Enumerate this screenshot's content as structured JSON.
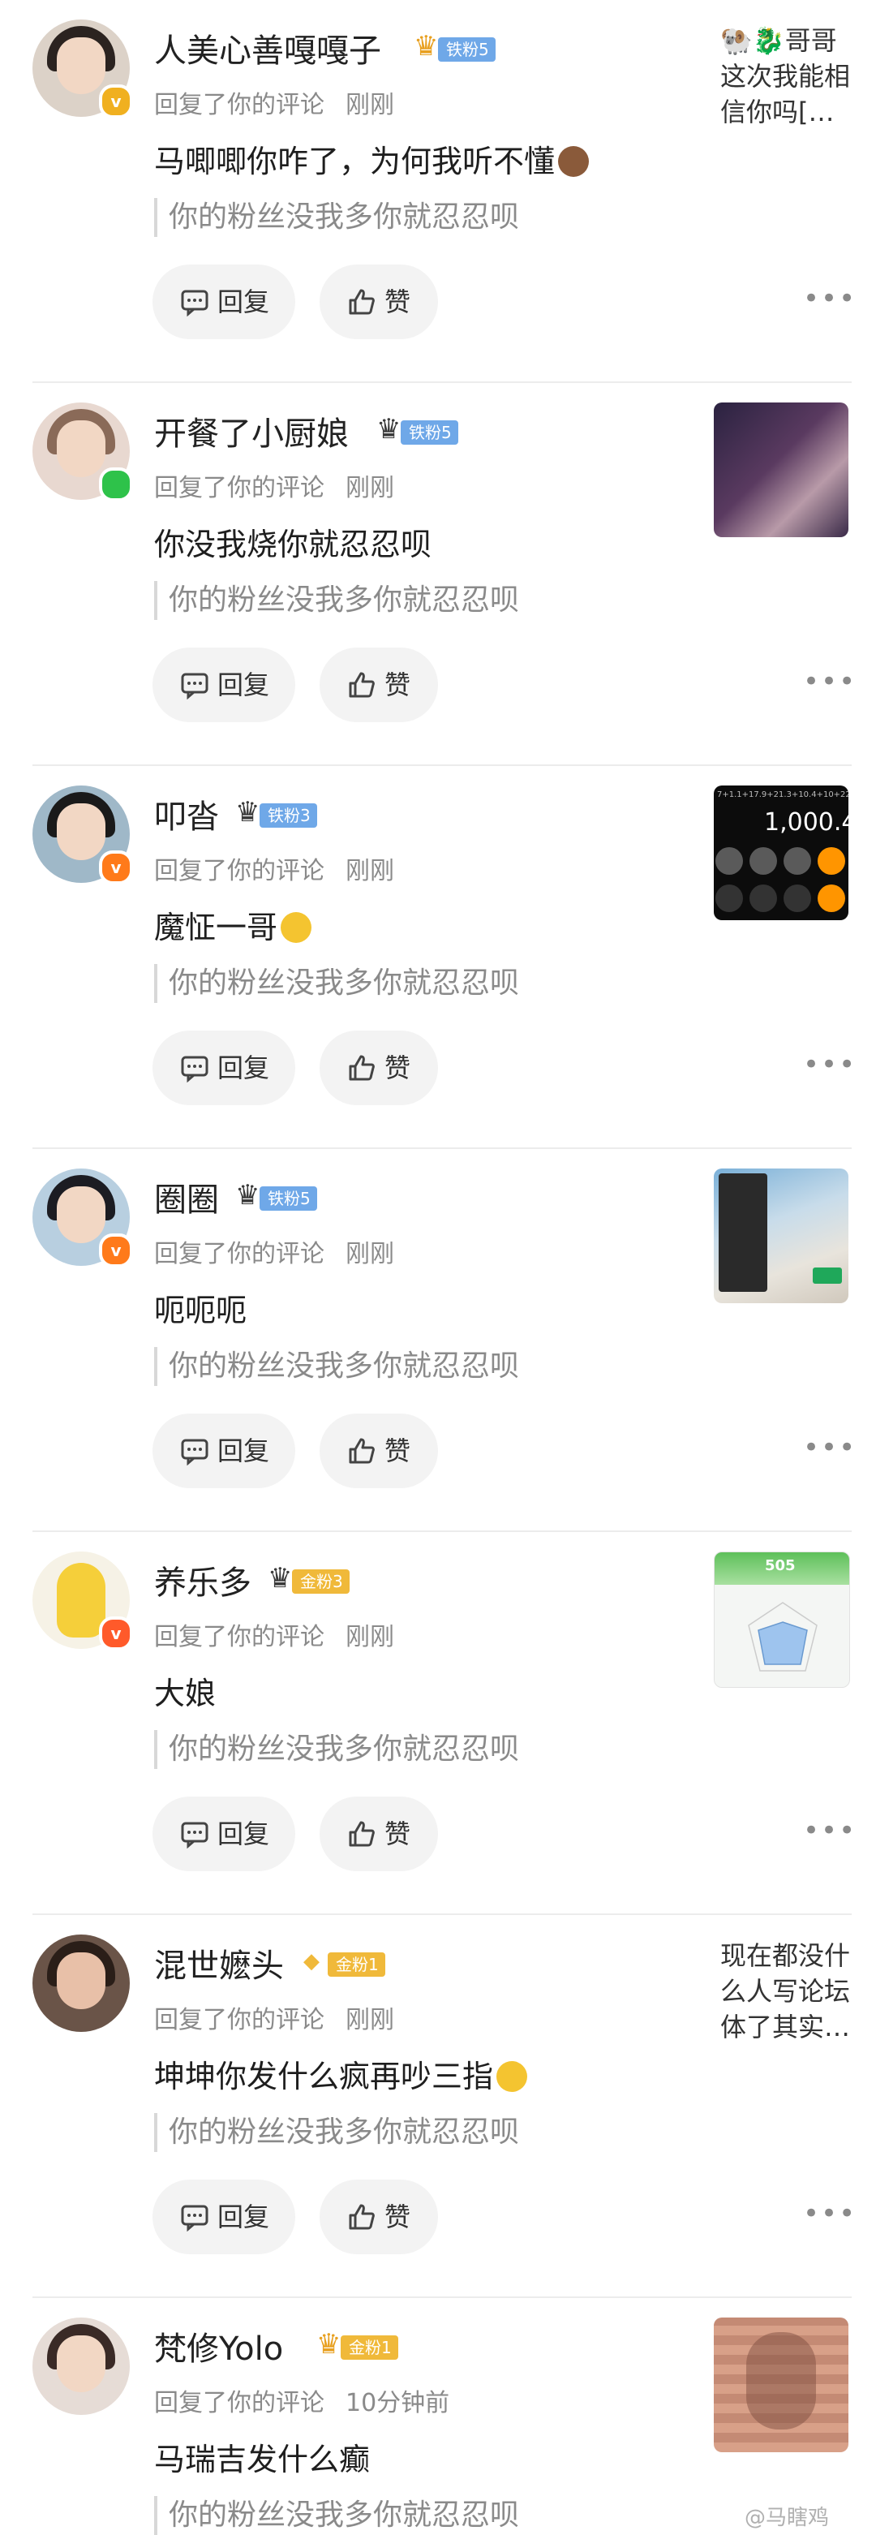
{
  "common": {
    "reply_meta": "回复了你的评论",
    "quote": "你的粉丝没我多你就忍忍呗",
    "reply_label": "回复",
    "like_label": "赞",
    "more_label": "•••"
  },
  "items": [
    {
      "name": "人美心善嘎嘎子",
      "fan_level": "铁粉5",
      "fan_type": "iron",
      "time": "刚刚",
      "text": "马唧唧你咋了，为何我听不懂",
      "emoji": "smile-emoji",
      "badge": "v",
      "snippet": "🐏🐉哥哥 这次我能相信你吗[…"
    },
    {
      "name": "开餐了小厨娘",
      "fan_level": "铁粉5",
      "fan_type": "iron",
      "time": "刚刚",
      "text": "你没我烧你就忍忍呗",
      "emoji": "",
      "badge": "online"
    },
    {
      "name": "叩沓",
      "fan_level": "铁粉3",
      "fan_type": "iron",
      "time": "刚刚",
      "text": "魔怔一哥",
      "emoji": "sad-emoji",
      "badge": "v",
      "thumb_text": "7+1.1+17.9+21.3+10.4+10+22",
      "thumb_value": "1,000.4"
    },
    {
      "name": "圈圈",
      "fan_level": "铁粉5",
      "fan_type": "iron",
      "time": "刚刚",
      "text": "呃呃呃",
      "emoji": "",
      "badge": "v"
    },
    {
      "name": "养乐多",
      "fan_level": "金粉3",
      "fan_type": "gold",
      "time": "刚刚",
      "text": "大娘",
      "emoji": "",
      "badge": "v",
      "thumb_text": "505"
    },
    {
      "name": "混世嬷头",
      "fan_level": "金粉1",
      "fan_type": "gold",
      "time": "刚刚",
      "text": "坤坤你发什么疯再吵三指",
      "emoji": "laugh-emoji",
      "badge": "",
      "snippet": "现在都没什么人写论坛体了其实…"
    },
    {
      "name": "梵修Yolo",
      "fan_level": "金粉1",
      "fan_type": "gold",
      "time": "10分钟前",
      "text": "马瑞吉发什么癫",
      "emoji": "",
      "badge": ""
    }
  ],
  "watermark": "@马瞎鸡",
  "colors": {
    "iron": "#6fa8e8",
    "gold": "#f0b93a",
    "badge_v": "#f0a020",
    "badge_orange": "#ff7a1a",
    "online": "#2ec24a"
  }
}
